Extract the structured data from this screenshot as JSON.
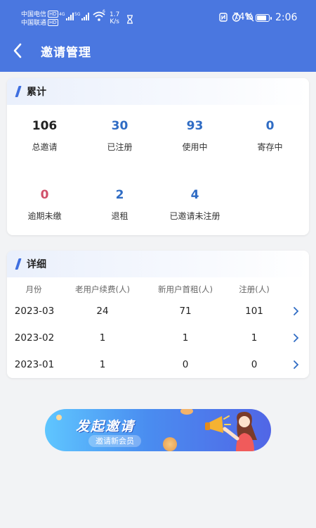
{
  "status_bar": {
    "carrier1": "中国电信",
    "carrier2": "中国联通",
    "hd": "HD",
    "net1": "4G",
    "net2": "5G",
    "net3": "6",
    "speed_value": "1.7",
    "speed_unit": "K/s",
    "battery": "74%",
    "time": "2:06"
  },
  "header": {
    "title": "邀请管理"
  },
  "summary": {
    "title": "累计",
    "stats": [
      {
        "value": "106",
        "label": "总邀请",
        "color": "#222222"
      },
      {
        "value": "30",
        "label": "已注册",
        "color": "#2f6cc4"
      },
      {
        "value": "93",
        "label": "使用中",
        "color": "#2f6cc4"
      },
      {
        "value": "0",
        "label": "寄存中",
        "color": "#2f6cc4"
      },
      {
        "value": "0",
        "label": "逾期未缴",
        "color": "#d0506a"
      },
      {
        "value": "2",
        "label": "退租",
        "color": "#2f6cc4"
      },
      {
        "value": "4",
        "label": "已邀请未注册",
        "color": "#2f6cc4"
      }
    ]
  },
  "details": {
    "title": "详细",
    "columns": [
      "月份",
      "老用户续费(人)",
      "新用户首租(人)",
      "注册(人)"
    ],
    "rows": [
      {
        "month": "2023-03",
        "renew": "24",
        "new_rent": "71",
        "register": "101"
      },
      {
        "month": "2023-02",
        "renew": "1",
        "new_rent": "1",
        "register": "1"
      },
      {
        "month": "2023-01",
        "renew": "1",
        "new_rent": "0",
        "register": "0"
      }
    ]
  },
  "banner": {
    "title": "发起邀请",
    "subtitle": "邀请新会员"
  },
  "colors": {
    "primary": "#4a77e0",
    "accent_blue": "#2f6cc4",
    "overdue_red": "#d0506a",
    "background": "#f2f3f5"
  },
  "icons": [
    "back-icon",
    "signal-icon",
    "wifi-icon",
    "hourglass-icon",
    "nfc-icon",
    "alarm-icon",
    "mute-icon",
    "battery-icon",
    "chevron-right-icon",
    "megaphone-icon"
  ]
}
